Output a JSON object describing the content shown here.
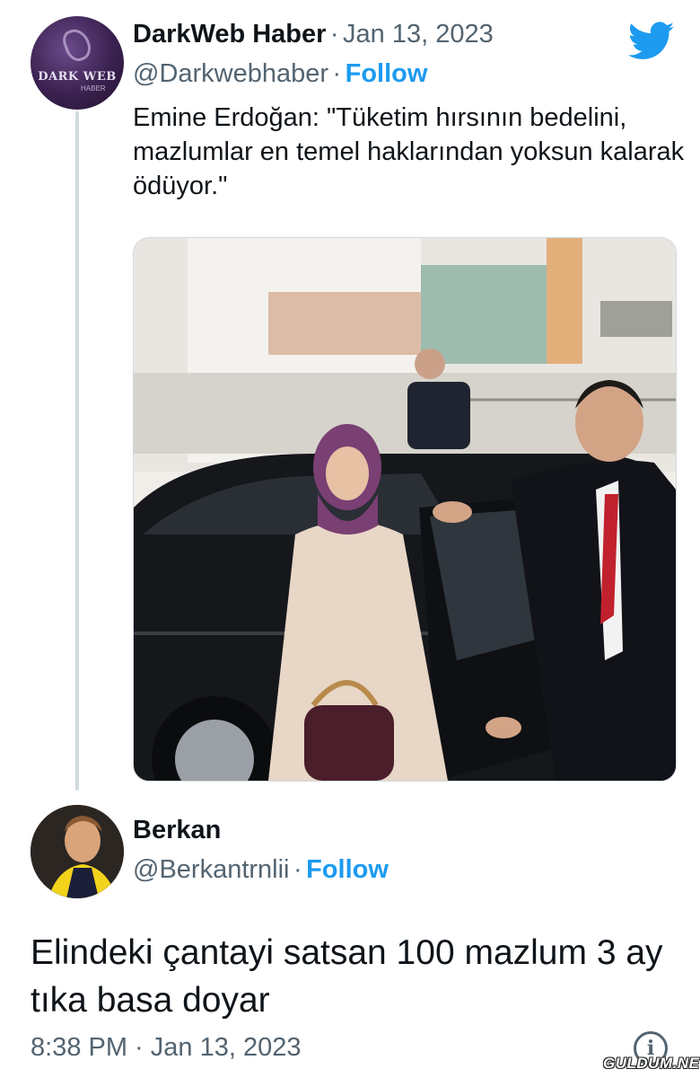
{
  "tweet": {
    "author_name": "DarkWeb Haber",
    "separator": "·",
    "date": "Jan 13, 2023",
    "handle": "@Darkwebhaber",
    "follow_label": "Follow",
    "text": "Emine Erdoğan: \"Tüketim hırsının bedelini, mazlumlar en temel haklarından yoksun kalarak ödüyor.\"",
    "avatar_text": "DARK WEB",
    "avatar_subtext": "HABER",
    "brand_icon": "twitter-bird-icon",
    "accent_color": "#1d9bf0"
  },
  "reply": {
    "author_name": "Berkan",
    "handle": "@Berkantrnlii",
    "separator": "·",
    "follow_label": "Follow",
    "text": "Elindeki çantayi satsan 100 mazlum 3 ay tıka basa doyar",
    "timestamp": "8:38 PM · Jan 13, 2023",
    "info_icon": "info-icon",
    "info_glyph": "i"
  },
  "watermark": "GULDUM.NET"
}
